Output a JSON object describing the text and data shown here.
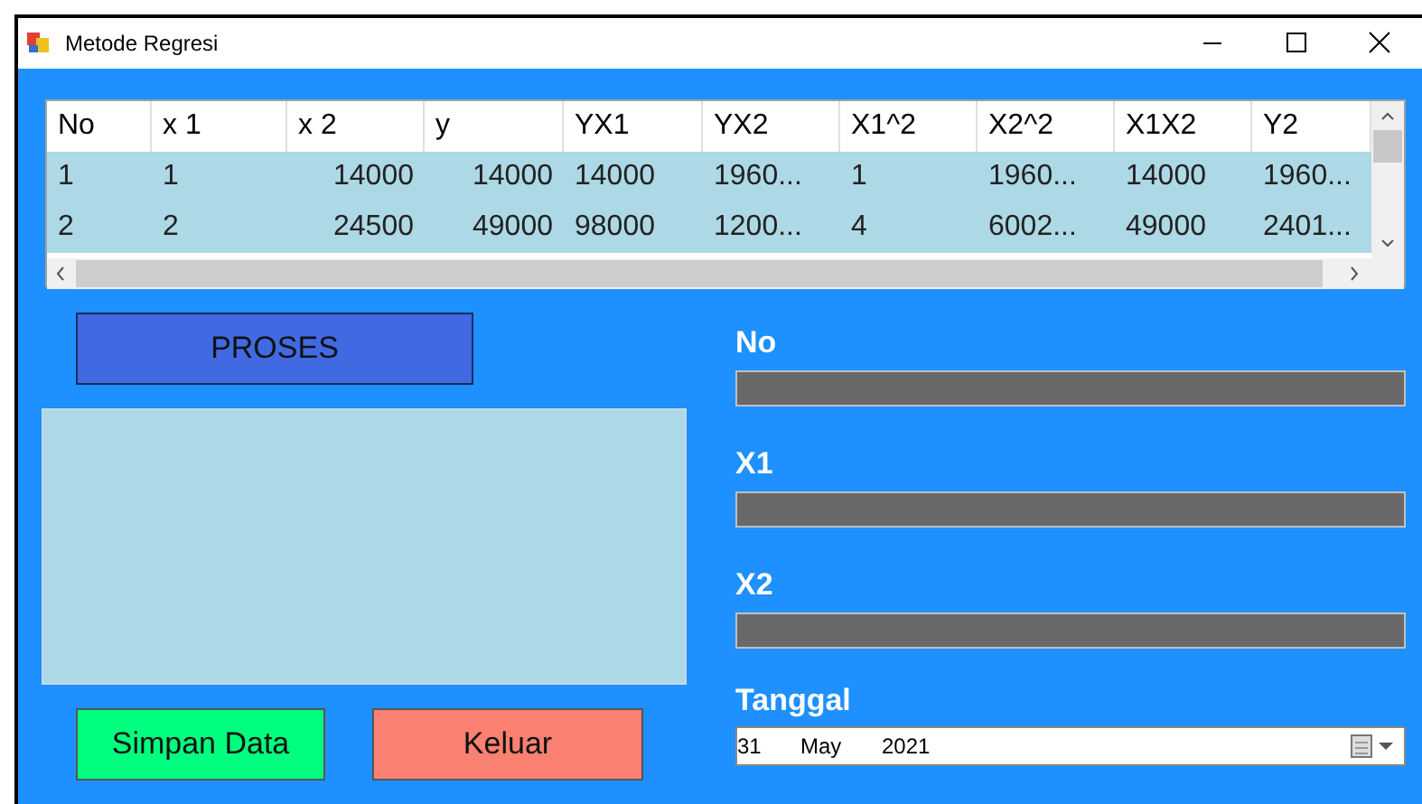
{
  "window": {
    "title": "Metode Regresi"
  },
  "table": {
    "columns": [
      "No",
      "x 1",
      "x 2",
      "y",
      "YX1",
      "YX2",
      "X1^2",
      "X2^2",
      "X1X2",
      "Y2"
    ],
    "rows": [
      [
        "1",
        "1",
        "14000",
        "14000",
        "14000",
        "1960...",
        "1",
        "1960...",
        "14000",
        "1960..."
      ],
      [
        "2",
        "2",
        "24500",
        "49000",
        "98000",
        "1200...",
        "4",
        "6002...",
        "49000",
        "2401..."
      ]
    ]
  },
  "buttons": {
    "process": "PROSES",
    "save": "Simpan Data",
    "exit": "Keluar"
  },
  "fields": [
    {
      "label": "No"
    },
    {
      "label": "X1"
    },
    {
      "label": "X2"
    }
  ],
  "date": {
    "label": "Tanggal",
    "day": "31",
    "month": "May",
    "year": "2021"
  }
}
